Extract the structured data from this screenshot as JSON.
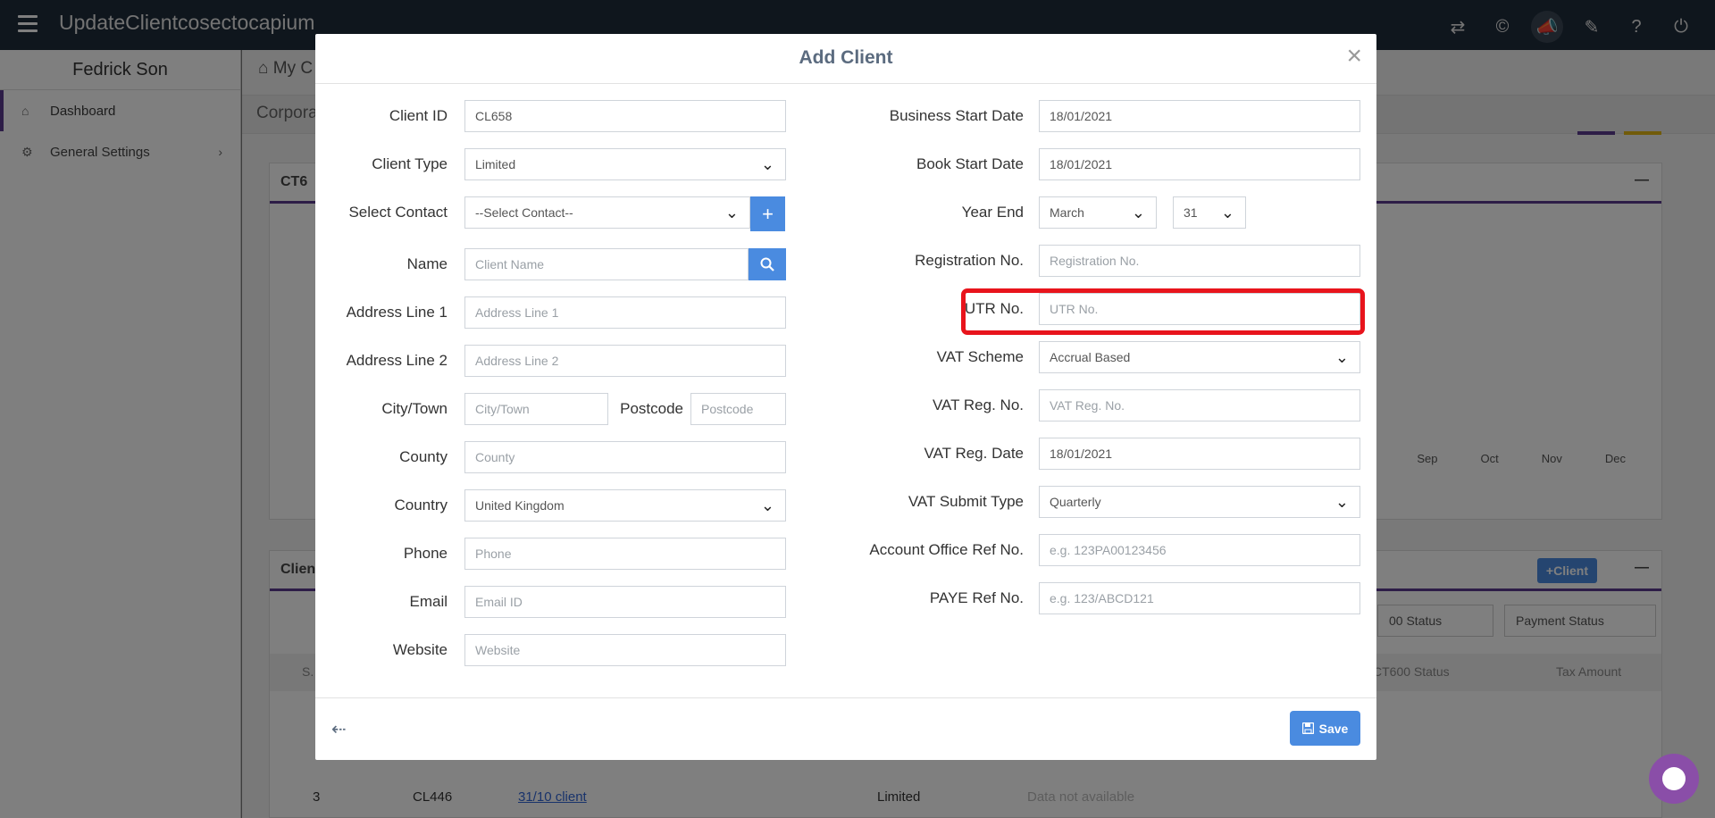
{
  "app": {
    "title": "UpdateClientcosectocapium",
    "user_name": "Fedrick Son",
    "breadcrumb": "My C",
    "subtitle": "Corpora",
    "accent_purple": "#5a3a8e",
    "accent_yellow": "#e2b714"
  },
  "sidebar": {
    "items": [
      {
        "label": "Dashboard",
        "icon": "home-icon"
      },
      {
        "label": "General Settings",
        "icon": "gears-icon"
      }
    ]
  },
  "background": {
    "panel1_title": "CT6",
    "months": [
      "Sep",
      "Oct",
      "Nov",
      "Dec"
    ],
    "panel2_title": "Clien",
    "client_button": "Client",
    "filters": [
      "00 Status",
      "Payment Status"
    ],
    "columns": [
      "S.",
      "CT600 Status",
      "Tax Amount"
    ],
    "row": {
      "num": "3",
      "id": "CL446",
      "name": "31/10 client",
      "type": "Limited",
      "status": "Data not available"
    }
  },
  "modal": {
    "title": "Add Client",
    "left": {
      "client_id": {
        "label": "Client ID",
        "value": "CL658"
      },
      "client_type": {
        "label": "Client Type",
        "value": "Limited"
      },
      "select_contact": {
        "label": "Select Contact",
        "value": "--Select Contact--"
      },
      "name": {
        "label": "Name",
        "placeholder": "Client Name"
      },
      "address1": {
        "label": "Address Line 1",
        "placeholder": "Address Line 1"
      },
      "address2": {
        "label": "Address Line 2",
        "placeholder": "Address Line 2"
      },
      "city": {
        "label": "City/Town",
        "placeholder": "City/Town"
      },
      "postcode": {
        "label": "Postcode",
        "placeholder": "Postcode"
      },
      "county": {
        "label": "County",
        "placeholder": "County"
      },
      "country": {
        "label": "Country",
        "value": "United Kingdom"
      },
      "phone": {
        "label": "Phone",
        "placeholder": "Phone"
      },
      "email": {
        "label": "Email",
        "placeholder": "Email ID"
      },
      "website": {
        "label": "Website",
        "placeholder": "Website"
      }
    },
    "right": {
      "business_start": {
        "label": "Business Start Date",
        "value": "18/01/2021"
      },
      "book_start": {
        "label": "Book Start Date",
        "value": "18/01/2021"
      },
      "year_end": {
        "label": "Year End",
        "month": "March",
        "day": "31"
      },
      "registration": {
        "label": "Registration No.",
        "placeholder": "Registration No."
      },
      "utr": {
        "label": "UTR No.",
        "placeholder": "UTR No."
      },
      "vat_scheme": {
        "label": "VAT Scheme",
        "value": "Accrual Based"
      },
      "vat_reg_no": {
        "label": "VAT Reg. No.",
        "placeholder": "VAT Reg. No."
      },
      "vat_reg_date": {
        "label": "VAT Reg. Date",
        "value": "18/01/2021"
      },
      "vat_submit": {
        "label": "VAT Submit Type",
        "value": "Quarterly"
      },
      "account_office": {
        "label": "Account Office Ref No.",
        "placeholder": "e.g. 123PA00123456"
      },
      "paye": {
        "label": "PAYE Ref No.",
        "placeholder": "e.g. 123/ABCD121"
      }
    },
    "save_label": "Save",
    "highlight_color": "#e8141c"
  }
}
